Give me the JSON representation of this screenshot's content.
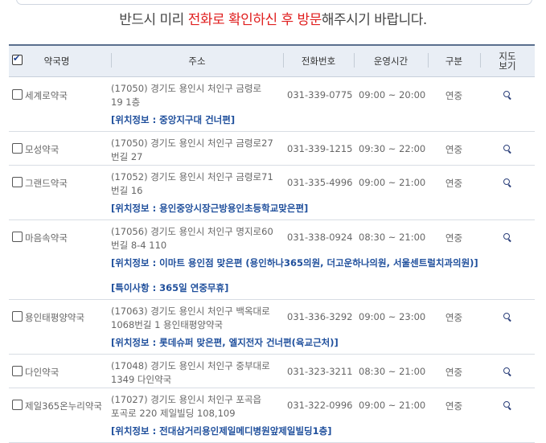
{
  "notice": {
    "part1": "반드시 미리 ",
    "part2": "전화로 확인하신 후 방문",
    "part3": "해주시기 바랍니다."
  },
  "columns": {
    "name": "약국명",
    "address": "주소",
    "tel": "전화번호",
    "hours": "운영시간",
    "type": "구분",
    "map_line1": "지도",
    "map_line2": "보기"
  },
  "rows": [
    {
      "name": "세계로약국",
      "addr1": "(17050) 경기도 용인시 처인구 금령로",
      "addr2": "19 1층",
      "tel": "031-339-0775",
      "hours": "09:00 ~ 20:00",
      "type": "연중",
      "info": "[위치정보 : 중앙지구대 건너편]"
    },
    {
      "name": "모성약국",
      "addr1": "(17050) 경기도 용인시 처인구 금령로27",
      "addr2": "번길 27",
      "tel": "031-339-1215",
      "hours": "09:30 ~ 22:00",
      "type": "연중"
    },
    {
      "name": "그랜드약국",
      "addr1": "(17052) 경기도 용인시 처인구 금령로71",
      "addr2": "번길 16",
      "tel": "031-335-4996",
      "hours": "09:00 ~ 21:00",
      "type": "연중",
      "info": "[위치정보 : 용인중앙시장근방용인초등학교맞은편]"
    },
    {
      "name": "마음속약국",
      "addr1": "(17056) 경기도 용인시 처인구 명지로60",
      "addr2": "번길 8-4 110",
      "tel": "031-338-0924",
      "hours": "08:30 ~ 21:00",
      "type": "연중",
      "info": "[위치정보 : 이마트 용인점 맞은편 (용인하나365의원, 더고운하나의원, 서울센트럴치과의원)]",
      "info2": "[특이사항 : 365일 연중무휴]"
    },
    {
      "name": "용인태평양약국",
      "addr1": "(17063) 경기도 용인시 처인구 백옥대로",
      "addr2": "1068번길 1 용인태평양약국",
      "tel": "031-336-3292",
      "hours": "09:00 ~ 23:00",
      "type": "연중",
      "info": "[위치정보 : 롯데슈퍼 맞은편, 엘지전자 건너편(육교근처)]"
    },
    {
      "name": "다인약국",
      "addr1": "(17048) 경기도 용인시 처인구 중부대로",
      "addr2": "1349 다인약국",
      "tel": "031-323-3211",
      "hours": "08:30 ~ 21:00",
      "type": "연중"
    },
    {
      "name": "제일365온누리약국",
      "addr1": "(17027) 경기도 용인시 처인구 포곡읍",
      "addr2": "포곡로 220 제일빌딩 108,109",
      "tel": "031-322-0996",
      "hours": "09:00 ~ 21:00",
      "type": "연중",
      "info": "[위치정보 : 전대삼거리용인제일메디병원앞제일빌딩1층]"
    }
  ]
}
